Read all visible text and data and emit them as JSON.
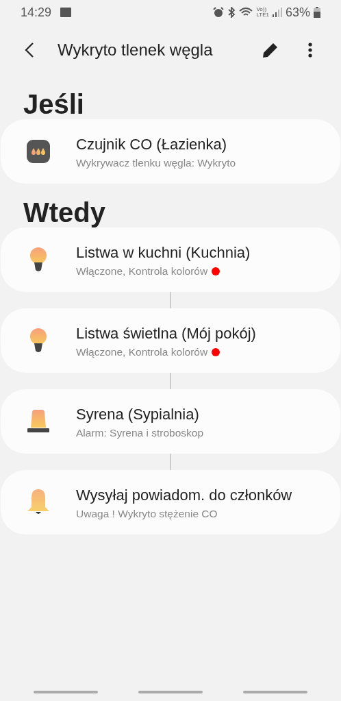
{
  "status_bar": {
    "time": "14:29",
    "volte": "Vo))",
    "lte": "LTE1",
    "battery": "63%"
  },
  "toolbar": {
    "title": "Wykryto tlenek węgla"
  },
  "if_section": {
    "heading": "Jeśli",
    "cards": [
      {
        "kind": "sensor",
        "title": "Czujnik CO (Łazienka)",
        "subtitle": "Wykrywacz tlenku węgla: Wykryto"
      }
    ]
  },
  "then_section": {
    "heading": "Wtedy",
    "cards": [
      {
        "kind": "lamp",
        "title": "Listwa w kuchni (Kuchnia)",
        "subtitle": "Włączone, Kontrola kolorów",
        "color": "#ff0000"
      },
      {
        "kind": "lamp",
        "title": "Listwa świetlna (Mój pokój)",
        "subtitle": "Włączone, Kontrola kolorów",
        "color": "#ff0000"
      },
      {
        "kind": "siren",
        "title": "Syrena (Sypialnia)",
        "subtitle": "Alarm: Syrena i stroboskop"
      },
      {
        "kind": "bell",
        "title": "Wysyłaj powiadom. do członków",
        "subtitle": "Uwaga ! Wykryto stężenie CO"
      }
    ]
  }
}
